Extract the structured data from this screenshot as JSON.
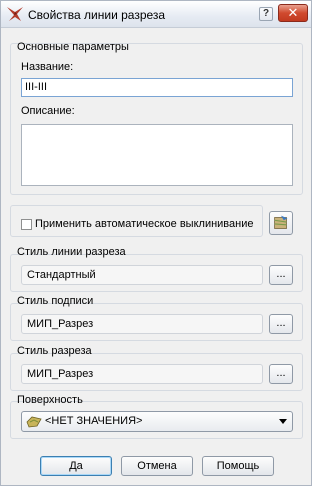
{
  "window": {
    "title": "Свойства линии разреза",
    "help_glyph": "?",
    "close_glyph": "✕"
  },
  "main_params": {
    "group_label": "Основные параметры",
    "name_label": "Название:",
    "name_value": "III-III",
    "description_label": "Описание:",
    "description_value": ""
  },
  "auto_wrap": {
    "label": "Применить автоматическое выклинивание",
    "checked": false
  },
  "section_line_style": {
    "label": "Стиль линии разреза",
    "value": "Стандартный",
    "browse": "..."
  },
  "caption_style": {
    "label": "Стиль подписи",
    "value": "МИП_Разрез",
    "browse": "..."
  },
  "section_style": {
    "label": "Стиль разреза",
    "value": "МИП_Разрез",
    "browse": "..."
  },
  "surface": {
    "label": "Поверхность",
    "selected": "<НЕТ ЗНАЧЕНИЯ>"
  },
  "buttons": {
    "ok": "Да",
    "cancel": "Отмена",
    "help": "Помощь"
  },
  "colors": {
    "close_button": "#c23a20",
    "input_focus_border": "#7aa4d4",
    "dialog_bg": "#f0f0f0"
  }
}
